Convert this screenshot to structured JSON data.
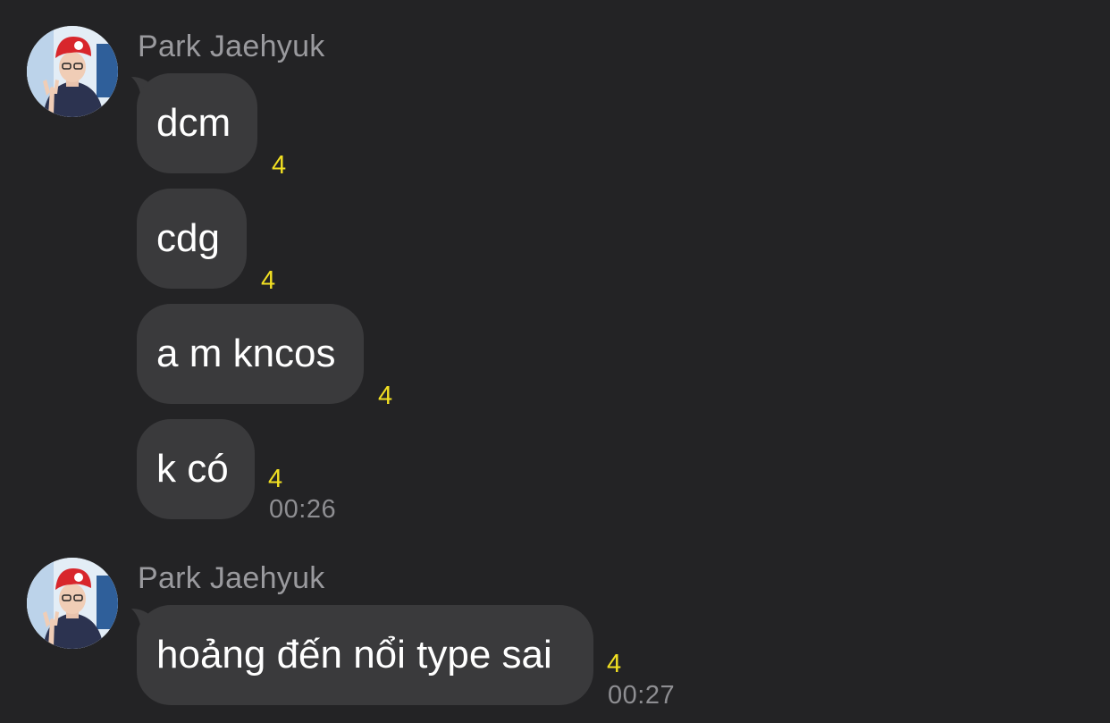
{
  "groups": [
    {
      "sender": "Park Jaehyuk",
      "avatar_icon": "profile-photo-icon",
      "messages": [
        {
          "text": "dcm",
          "unread": "4",
          "time": ""
        },
        {
          "text": "cdg",
          "unread": "4",
          "time": ""
        },
        {
          "text": "a m kncos",
          "unread": "4",
          "time": ""
        },
        {
          "text": "k có",
          "unread": "4",
          "time": "00:26"
        }
      ]
    },
    {
      "sender": "Park Jaehyuk",
      "avatar_icon": "profile-photo-icon",
      "messages": [
        {
          "text": "hoảng đến nổi type sai",
          "unread": "4",
          "time": "00:27"
        }
      ]
    }
  ],
  "colors": {
    "background": "#232325",
    "bubble": "#3a3a3c",
    "unread": "#f2e022",
    "sender": "#9a9a9e"
  }
}
